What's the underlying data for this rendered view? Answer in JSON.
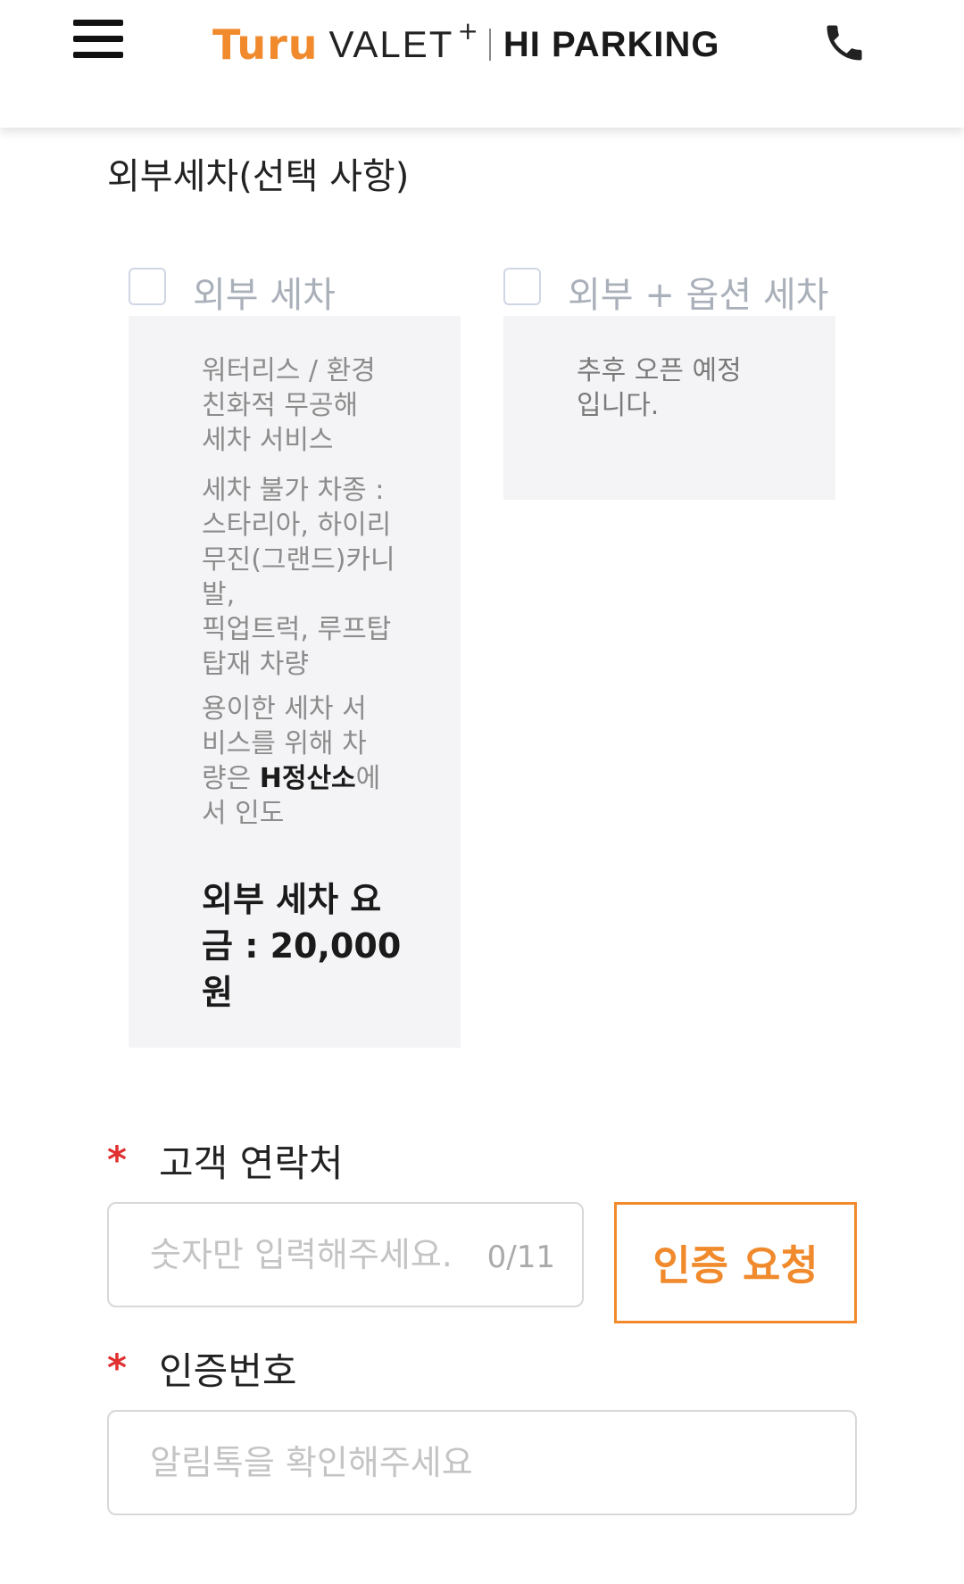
{
  "header": {
    "brand_turu": "Turu",
    "brand_valet": "VALET",
    "brand_plus": "+",
    "brand_hiparking": "HI PARKING"
  },
  "section": {
    "title": "외부세차(선택 사항)"
  },
  "options": [
    {
      "label": "외부 세차",
      "checked": false,
      "lines": [
        [
          "워터리스 / 환경",
          "친화적 무공해",
          "세차 서비스"
        ],
        [
          "세차 불가 차종 :",
          "스타리아, 하이리",
          "무진(그랜드)카니",
          "발,",
          "픽업트럭, 루프탑",
          "탑재 차량"
        ]
      ],
      "note_pre_1": "용이한 세차 서",
      "note_pre_2": "비스를 위해 차",
      "note_pre_3": "량은 ",
      "note_bold": "H정산소",
      "note_post_3": "에",
      "note_post_4": "서 인도",
      "price_lines": [
        "외부 세차 요",
        "금 : 20,000",
        "원"
      ]
    },
    {
      "label": "외부 + 옵션 세차",
      "checked": false,
      "lines": [
        [
          "추후 오픈 예정",
          "입니다."
        ]
      ]
    }
  ],
  "form": {
    "required_mark": "*",
    "phone": {
      "label": "고객 연락처",
      "placeholder": "숫자만 입력해주세요.",
      "counter": "0/11",
      "button_label": "인증 요청"
    },
    "code": {
      "label": "인증번호",
      "placeholder": "알림톡을 확인해주세요"
    }
  },
  "colors": {
    "accent": "#f08a2c",
    "required": "#e03030",
    "card_bg": "#f4f4f6"
  }
}
